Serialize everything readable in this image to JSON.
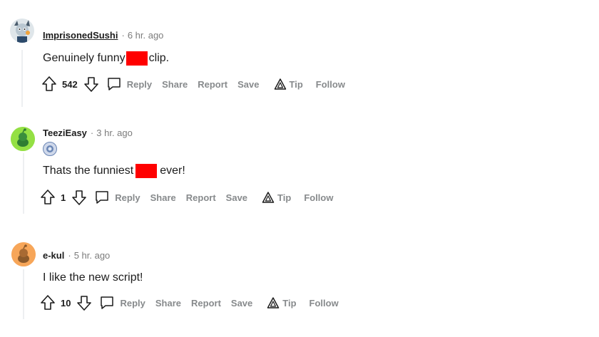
{
  "comments": [
    {
      "username": "ImprisonedSushi",
      "timestamp": "6 hr. ago",
      "text_before": "Genuinely funny",
      "text_after": "clip.",
      "score": "542",
      "actions": {
        "reply": "Reply",
        "share": "Share",
        "report": "Report",
        "save": "Save",
        "tip": "Tip",
        "follow": "Follow"
      }
    },
    {
      "username": "TeeziEasy",
      "timestamp": "3 hr. ago",
      "text_before": "Thats the funniest",
      "text_after": "ever!",
      "score": "1",
      "actions": {
        "reply": "Reply",
        "share": "Share",
        "report": "Report",
        "save": "Save",
        "tip": "Tip",
        "follow": "Follow"
      }
    },
    {
      "username": "e-kul",
      "timestamp": "5 hr. ago",
      "text": "I like the new script!",
      "score": "10",
      "actions": {
        "reply": "Reply",
        "share": "Share",
        "report": "Report",
        "save": "Save",
        "tip": "Tip",
        "follow": "Follow"
      }
    }
  ],
  "separator": "·",
  "icons": {
    "upvote": "arrow-up-icon",
    "downvote": "arrow-down-icon",
    "reply": "speech-bubble-icon",
    "tip": "triangle-tip-icon"
  },
  "colors": {
    "redaction": "#ff0000",
    "muted_text": "#878a8c",
    "avatar_green": "#94e044",
    "avatar_orange": "#f7a659"
  }
}
